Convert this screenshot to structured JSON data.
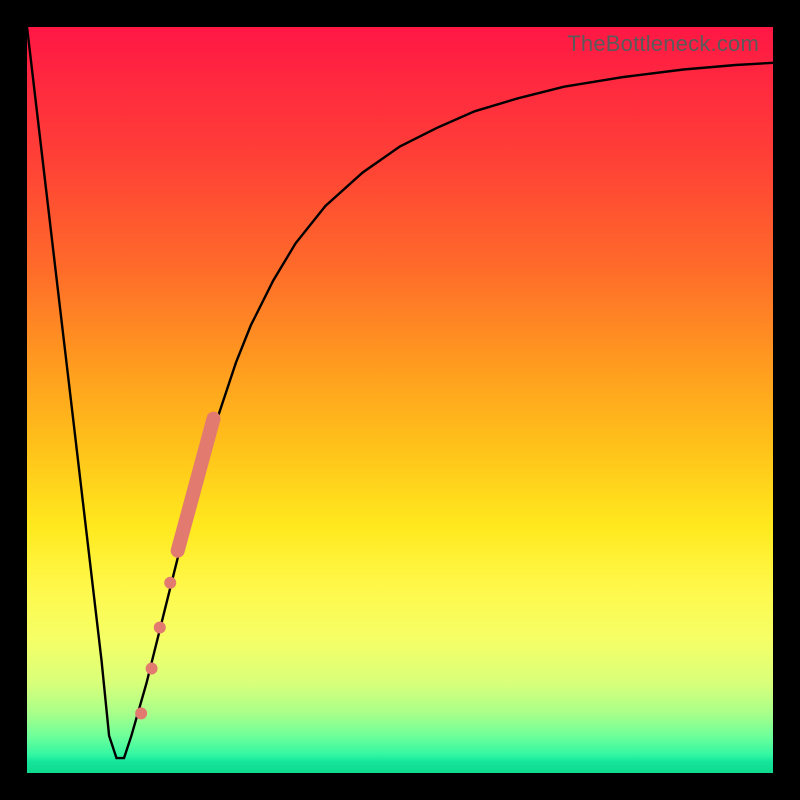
{
  "watermark": "TheBottleneck.com",
  "colors": {
    "curve": "#000000",
    "marker": "#e37a6f",
    "frame": "#000000"
  },
  "chart_data": {
    "type": "line",
    "title": "",
    "xlabel": "",
    "ylabel": "",
    "xlim": [
      0,
      100
    ],
    "ylim": [
      0,
      100
    ],
    "series": [
      {
        "name": "bottleneck-curve",
        "x": [
          0,
          2,
          4,
          6,
          8,
          10,
          11,
          12,
          13,
          14,
          16,
          18,
          20,
          22,
          24,
          26,
          28,
          30,
          33,
          36,
          40,
          45,
          50,
          55,
          60,
          66,
          72,
          80,
          88,
          95,
          100
        ],
        "y": [
          100,
          83,
          66,
          49,
          32,
          15,
          5,
          2,
          2,
          5,
          12,
          20,
          28,
          36,
          43,
          49,
          55,
          60,
          66,
          71,
          76,
          80.5,
          84,
          86.5,
          88.7,
          90.5,
          92,
          93.3,
          94.3,
          94.9,
          95.2
        ]
      }
    ],
    "markers": [
      {
        "x": 15.3,
        "y": 8,
        "r": 6
      },
      {
        "x": 16.7,
        "y": 14,
        "r": 6
      },
      {
        "x": 17.8,
        "y": 19.5,
        "r": 6
      },
      {
        "x": 19.2,
        "y": 25.5,
        "r": 6
      }
    ],
    "marker_band": {
      "x0": 20.2,
      "y0": 29.8,
      "x1": 25.0,
      "y1": 47.5,
      "width": 14
    }
  }
}
